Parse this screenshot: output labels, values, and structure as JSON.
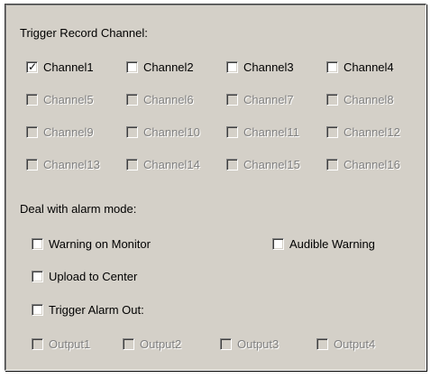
{
  "trigger_record": {
    "title": "Trigger Record Channel:",
    "channels": [
      {
        "label": "Channel1",
        "checked": true,
        "enabled": true
      },
      {
        "label": "Channel2",
        "checked": false,
        "enabled": true
      },
      {
        "label": "Channel3",
        "checked": false,
        "enabled": true
      },
      {
        "label": "Channel4",
        "checked": false,
        "enabled": true
      },
      {
        "label": "Channel5",
        "checked": false,
        "enabled": false
      },
      {
        "label": "Channel6",
        "checked": false,
        "enabled": false
      },
      {
        "label": "Channel7",
        "checked": false,
        "enabled": false
      },
      {
        "label": "Channel8",
        "checked": false,
        "enabled": false
      },
      {
        "label": "Channel9",
        "checked": false,
        "enabled": false
      },
      {
        "label": "Channel10",
        "checked": false,
        "enabled": false
      },
      {
        "label": "Channel11",
        "checked": false,
        "enabled": false
      },
      {
        "label": "Channel12",
        "checked": false,
        "enabled": false
      },
      {
        "label": "Channel13",
        "checked": false,
        "enabled": false
      },
      {
        "label": "Channel14",
        "checked": false,
        "enabled": false
      },
      {
        "label": "Channel15",
        "checked": false,
        "enabled": false
      },
      {
        "label": "Channel16",
        "checked": false,
        "enabled": false
      }
    ]
  },
  "alarm_mode": {
    "title": "Deal with alarm mode:",
    "warning_on_monitor": {
      "label": "Warning on Monitor",
      "checked": false
    },
    "audible_warning": {
      "label": "Audible Warning",
      "checked": false
    },
    "upload_to_center": {
      "label": "Upload to Center",
      "checked": false
    },
    "trigger_alarm_out": {
      "label": "Trigger Alarm Out:",
      "checked": false
    },
    "outputs": [
      {
        "label": "Output1",
        "checked": false,
        "enabled": false
      },
      {
        "label": "Output2",
        "checked": false,
        "enabled": false
      },
      {
        "label": "Output3",
        "checked": false,
        "enabled": false
      },
      {
        "label": "Output4",
        "checked": false,
        "enabled": false
      }
    ]
  }
}
